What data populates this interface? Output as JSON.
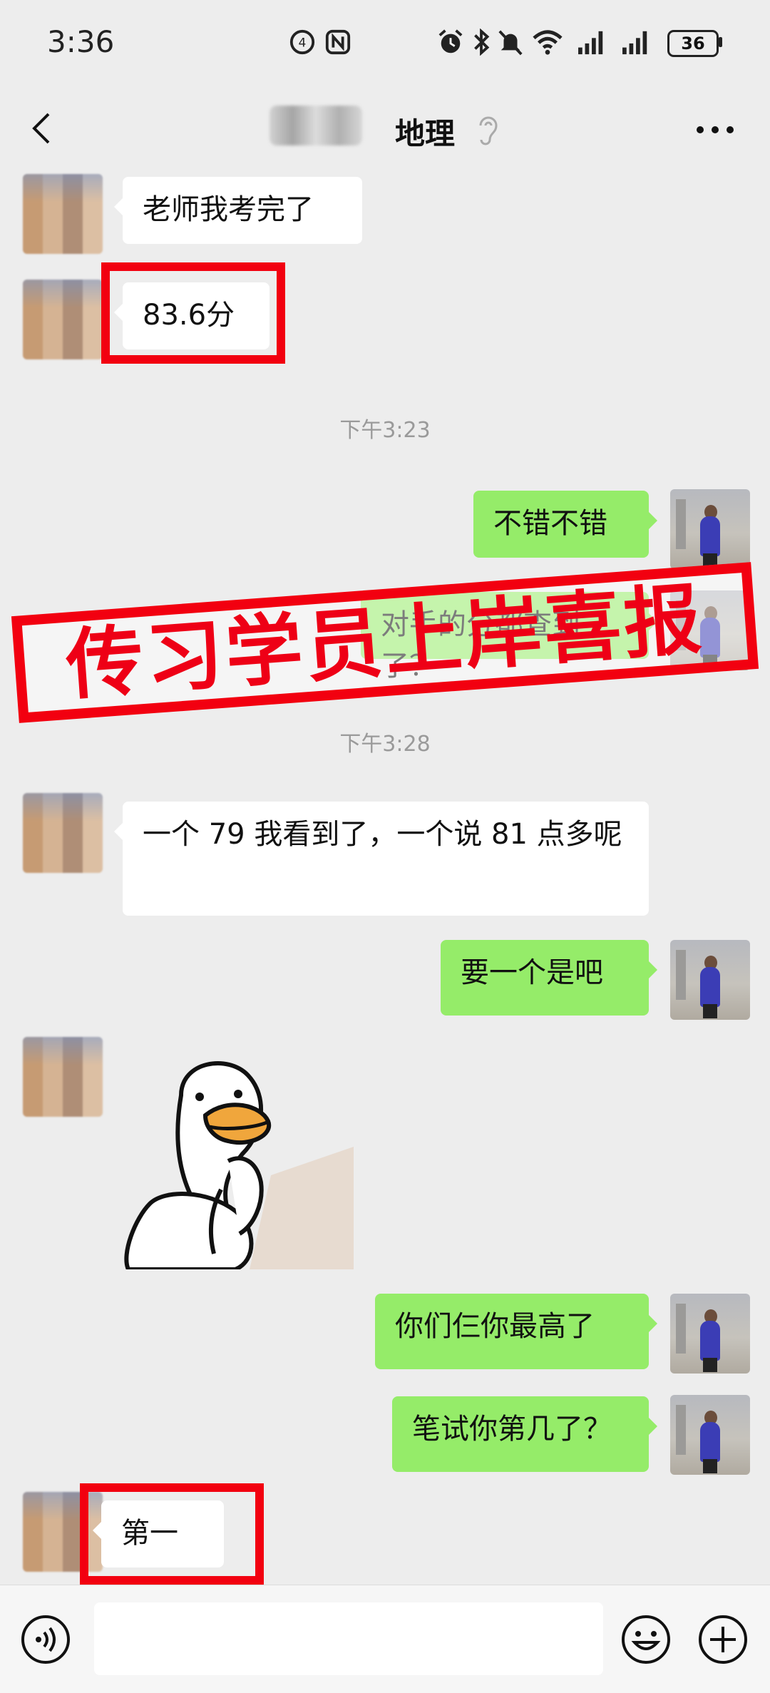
{
  "status_bar": {
    "time": "3:36",
    "battery": "36"
  },
  "header": {
    "title": "地理"
  },
  "messages": [
    {
      "side": "in",
      "text": "老师我考完了"
    },
    {
      "side": "in",
      "text": "83.6分"
    },
    {
      "type": "time",
      "text": "下午3:23"
    },
    {
      "side": "out",
      "text": "不错不错"
    },
    {
      "side": "out",
      "text": "对手的分都查到了？"
    },
    {
      "type": "time",
      "text": "下午3:28"
    },
    {
      "side": "in",
      "text": "一个 79 我看到了，一个说 81 点多呢"
    },
    {
      "side": "out",
      "text": "要一个是吧"
    },
    {
      "side": "in",
      "type": "sticker",
      "text": ""
    },
    {
      "side": "out",
      "text": "你们仨你最高了"
    },
    {
      "side": "out",
      "text": "笔试你第几了？"
    },
    {
      "side": "in",
      "text": "第一"
    }
  ],
  "banner": {
    "text": "传习学员上岸喜报",
    "color": "#ee0016"
  },
  "colors": {
    "out_bubble": "#95ec69",
    "in_bubble": "#ffffff",
    "background": "#ededed",
    "highlight": "#f20010"
  },
  "input_bar": {
    "icons": [
      "voice-icon",
      "emoji-icon",
      "plus-icon"
    ]
  }
}
